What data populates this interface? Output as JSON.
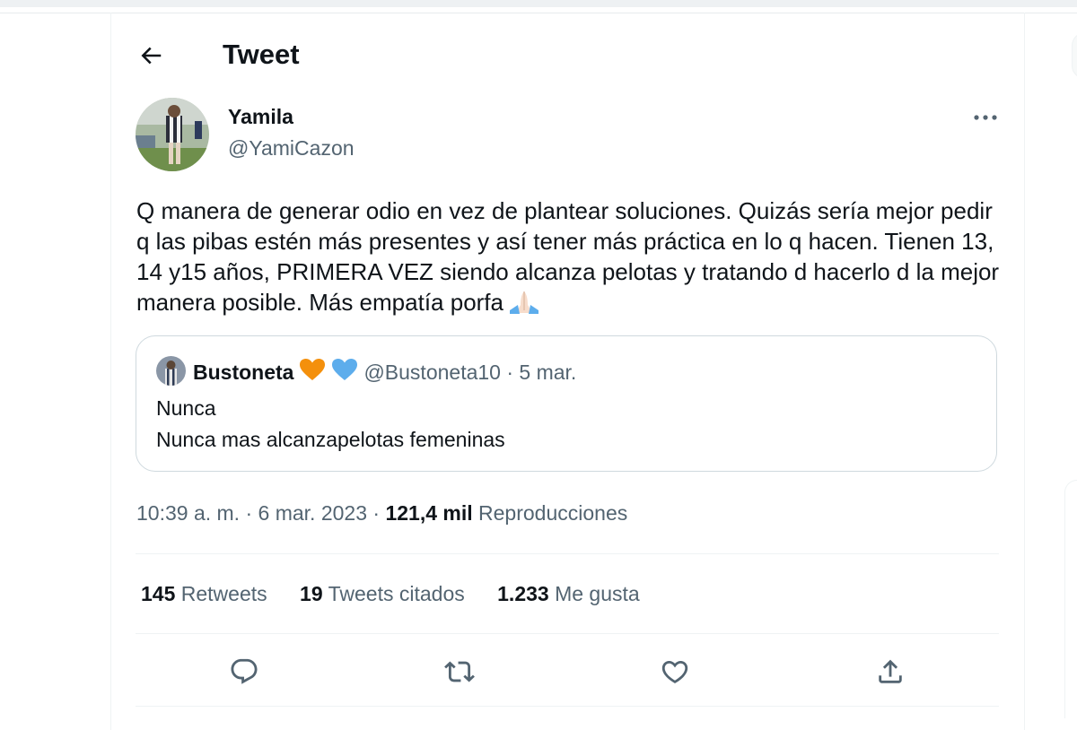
{
  "header": {
    "title": "Tweet"
  },
  "icons": {
    "back": "arrow-left-icon",
    "more": "more-horizontal-icon",
    "reply": "reply-icon",
    "retweet": "retweet-icon",
    "like": "heart-icon",
    "share": "share-icon"
  },
  "tweet": {
    "author_name": "Yamila",
    "author_handle": "@YamiCazon",
    "text": "Q manera de generar odio en vez de plantear soluciones. Quizás sería mejor pedir q las pibas estén más presentes y así tener más práctica en lo q hacen. Tienen 13, 14 y15 años, PRIMERA VEZ siendo alcanza pelotas y tratando d hacerlo d la mejor manera posible. Más empatía porfa",
    "time": "10:39 a. m.",
    "separator": "·",
    "date": "6 mar. 2023",
    "views_count": "121,4 mil",
    "views_label": "Reproducciones"
  },
  "quoted": {
    "name": "Bustoneta",
    "handle_date": "@Bustoneta10 · 5 mar.",
    "line1": "Nunca",
    "line2": "Nunca mas alcanzapelotas femeninas"
  },
  "stats": [
    {
      "count": "145",
      "label": "Retweets"
    },
    {
      "count": "19",
      "label": "Tweets citados"
    },
    {
      "count": "1.233",
      "label": "Me gusta"
    }
  ],
  "colors": {
    "text": "#0f1419",
    "secondary": "#536471",
    "border": "#cfd9de",
    "heart_orange": "#f4900c",
    "heart_blue": "#5dadec"
  }
}
